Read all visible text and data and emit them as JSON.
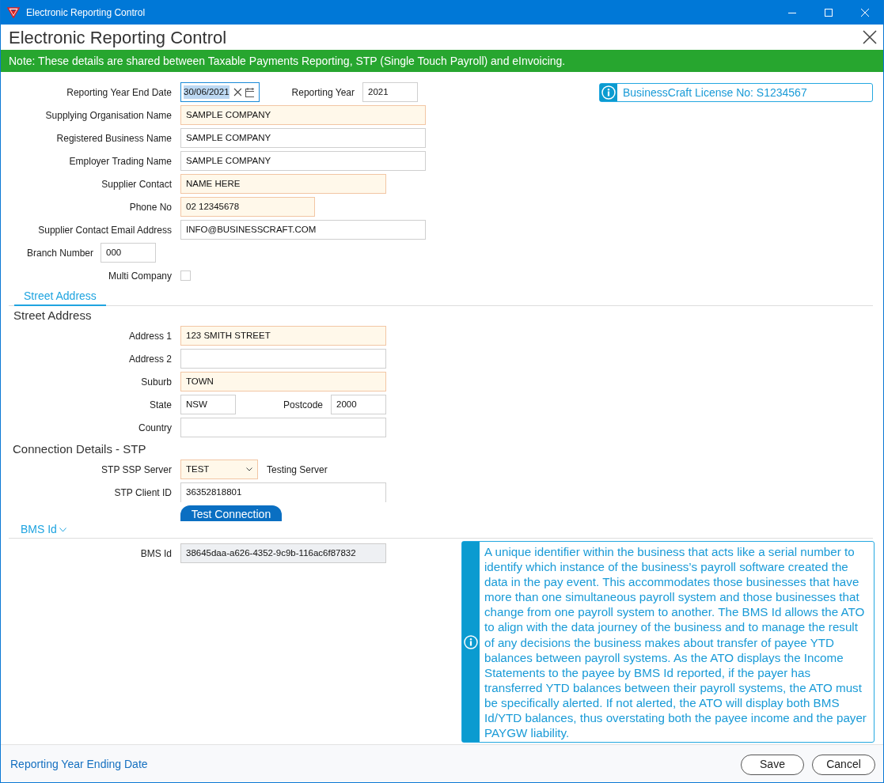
{
  "window": {
    "title": "Electronic Reporting Control"
  },
  "dialog": {
    "title": "Electronic Reporting Control"
  },
  "note": "Note: These details are shared between Taxable Payments Reporting, STP (Single Touch Payroll) and eInvoicing.",
  "license": "BusinessCraft License No: S1234567",
  "general": [
    {
      "kind": "standard",
      "fields": [
        {
          "kind": "date",
          "label": "Reporting Year End Date",
          "value": "30/06/2021",
          "required": false,
          "focused": true
        },
        {
          "kind": "text",
          "label": "Reporting Year",
          "value": "2021",
          "required": false
        }
      ]
    },
    {
      "kind": "standard",
      "fields": [
        {
          "kind": "text",
          "label": "Supplying Organisation Name",
          "value": "SAMPLE COMPANY",
          "required": true
        }
      ]
    },
    {
      "kind": "standard",
      "fields": [
        {
          "kind": "text",
          "label": "Registered Business Name",
          "value": "SAMPLE COMPANY",
          "required": false
        }
      ]
    },
    {
      "kind": "standard",
      "fields": [
        {
          "kind": "text",
          "label": "Employer Trading Name",
          "value": "SAMPLE COMPANY",
          "required": false
        }
      ]
    },
    {
      "kind": "standard",
      "fields": [
        {
          "kind": "text",
          "label": "Supplier Contact",
          "value": "NAME HERE",
          "required": true
        }
      ]
    },
    {
      "kind": "standard",
      "fields": [
        {
          "kind": "text",
          "label": "Phone No",
          "value": "02 12345678",
          "required": true
        }
      ]
    },
    {
      "kind": "standard",
      "fields": [
        {
          "kind": "text",
          "label": "Supplier Contact Email Address",
          "value": "INFO@BUSINESSCRAFT.COM",
          "required": false
        }
      ]
    },
    {
      "kind": "compact",
      "fields": [
        {
          "kind": "text",
          "label": "Branch Number",
          "value": "000",
          "required": false
        }
      ]
    },
    {
      "kind": "standard",
      "fields": [
        {
          "kind": "checkbox",
          "label": "Multi Company",
          "checked": false
        }
      ]
    }
  ],
  "tabs": [
    {
      "label": "Street Address",
      "selected": true
    }
  ],
  "address": {
    "heading": "Street Address",
    "rows": [
      {
        "fields": [
          {
            "kind": "text",
            "label": "Address 1",
            "value": "123 SMITH STREET",
            "required": true
          }
        ]
      },
      {
        "fields": [
          {
            "kind": "text",
            "label": "Address 2",
            "required": false
          }
        ]
      },
      {
        "fields": [
          {
            "kind": "text",
            "label": "Suburb",
            "value": "TOWN",
            "required": true
          }
        ]
      },
      {
        "fields": [
          {
            "kind": "text",
            "label": "State",
            "value": "NSW",
            "required": false
          },
          {
            "kind": "text",
            "label": "Postcode",
            "value": "2000",
            "required": false
          }
        ]
      },
      {
        "fields": [
          {
            "kind": "text",
            "label": "Country",
            "required": false
          }
        ]
      }
    ]
  },
  "connection": {
    "heading": "Connection Details - STP",
    "rows": [
      {
        "fields": [
          {
            "kind": "select",
            "label": "STP SSP Server",
            "value": "TEST",
            "required": true,
            "note": "Testing Server"
          }
        ]
      },
      {
        "fields": [
          {
            "kind": "text",
            "label": "STP Client ID",
            "value": "36352818801",
            "required": false
          }
        ]
      }
    ],
    "button": "Test Connection"
  },
  "bms": {
    "label": "BMS Id",
    "expanded": true,
    "rows": [
      {
        "fields": [
          {
            "kind": "readonly",
            "label": "BMS Id",
            "value": "38645daa-a626-4352-9c9b-116ac6f87832"
          }
        ]
      }
    ],
    "info": "A unique identifier within the business that acts like a serial number to identify which instance of the business’s payroll software created the data in the pay event. This accommodates those businesses that have more than one simultaneous payroll system and those businesses that change from one payroll system to another. The BMS Id allows the ATO to align with the data journey of the business and to manage the result of any decisions the business makes about transfer of payee YTD balances between payroll systems. As the ATO displays the Income Statements to the payee by BMS Id reported, if the payer has transferred YTD balances between their payroll systems, the ATO must be specifically alerted. If not alerted, the ATO will display both BMS Id/YTD balances, thus overstating both the payee income and the payer PAYGW liability."
  },
  "status_text": "Reporting Year Ending Date",
  "buttons": [
    "Save",
    "Cancel"
  ]
}
